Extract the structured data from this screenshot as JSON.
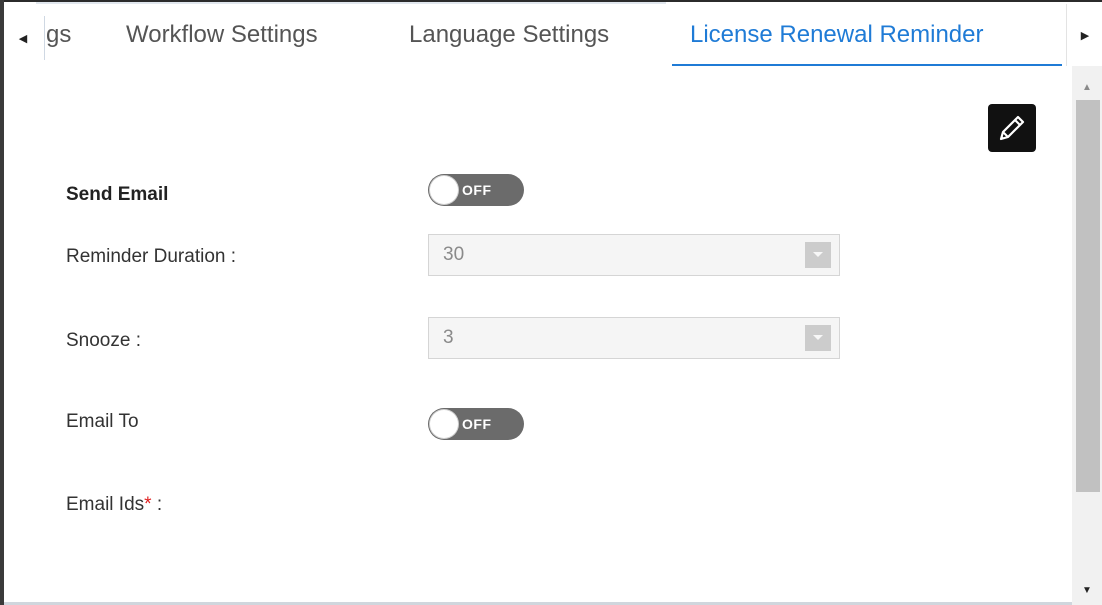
{
  "tabs": {
    "partial_label": "gs",
    "items": [
      {
        "label": "Workflow Settings"
      },
      {
        "label": "Language Settings"
      },
      {
        "label": "License Renewal Reminder"
      }
    ]
  },
  "form": {
    "send_email": {
      "label": "Send Email",
      "toggle": "OFF"
    },
    "reminder_duration": {
      "label": "Reminder Duration :",
      "value": "30"
    },
    "snooze": {
      "label": "Snooze :",
      "value": "3"
    },
    "email_to": {
      "label": "Email To",
      "toggle": "OFF"
    },
    "email_ids": {
      "label": "Email Ids",
      "required_mark": "*",
      "suffix": " :"
    }
  },
  "icons": {
    "edit": "pencil-icon",
    "scroll_left": "triangle-left-icon",
    "scroll_right": "triangle-right-icon",
    "dropdown": "chevron-down-icon"
  },
  "colors": {
    "accent": "#1f7bd6",
    "toggle_off": "#6b6b6b",
    "required": "#e02020"
  }
}
